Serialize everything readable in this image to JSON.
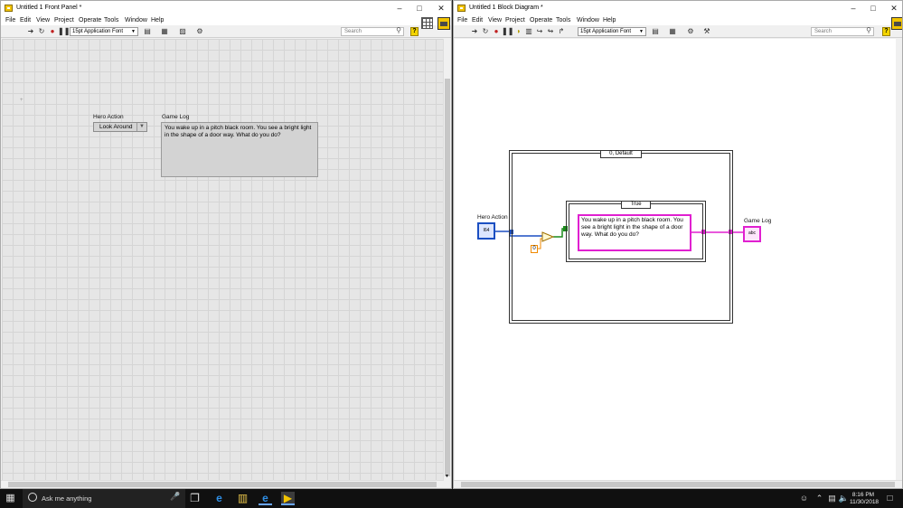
{
  "front_panel": {
    "title": "Untitled 1 Front Panel *",
    "menu": [
      "File",
      "Edit",
      "View",
      "Project",
      "Operate",
      "Tools",
      "Window",
      "Help"
    ],
    "font": "15pt Application Font",
    "search_placeholder": "Search",
    "controls": {
      "hero_action_label": "Hero Action",
      "hero_action_value": "Look Around",
      "game_log_label": "Game Log",
      "game_log_value": "You wake up in a pitch black room. You see a bright light in the shape of a door way. What do you do?"
    }
  },
  "block_diagram": {
    "title": "Untitled 1 Block Diagram *",
    "menu": [
      "File",
      "Edit",
      "View",
      "Project",
      "Operate",
      "Tools",
      "Window",
      "Help"
    ],
    "font": "15pt Application Font",
    "search_placeholder": "Search",
    "outer_case_selector": "0, Default",
    "inner_case_selector": "True",
    "hero_action_terminal_label": "Hero Action",
    "hero_action_terminal_text": "I64",
    "constant_value": "0",
    "string_constant": "You wake up in a pitch black room. You see a bright light in the shape of a door way. What do you do?",
    "game_log_terminal_label": "Game Log",
    "game_log_terminal_text": "abc"
  },
  "taskbar": {
    "search_placeholder": "Ask me anything",
    "time": "8:16 PM",
    "date": "11/30/2018"
  },
  "colors": {
    "wire_numeric": "#1b4fc2",
    "wire_orange": "#f08a00",
    "wire_boolean": "#1a8a1a",
    "wire_string": "#e020d0"
  }
}
